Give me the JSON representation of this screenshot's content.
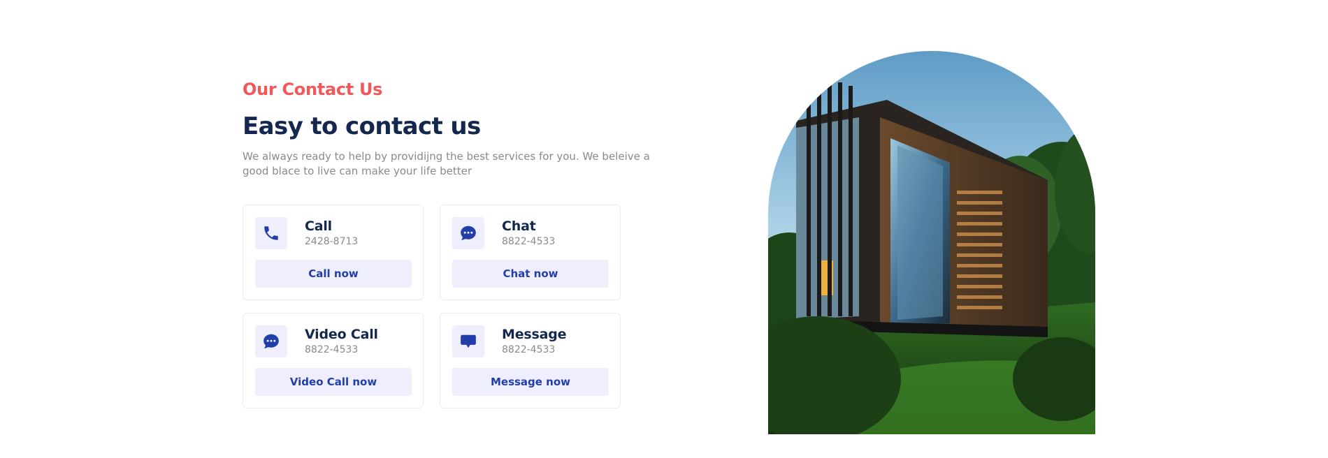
{
  "contact": {
    "eyebrow": "Our Contact Us",
    "heading": "Easy to contact us",
    "description": "We always ready to help by providijng the best services for you. We beleive a good blace to live can make your life better",
    "cards": [
      {
        "title": "Call",
        "number": "2428-8713",
        "button": "Call now",
        "icon": "phone-icon"
      },
      {
        "title": "Chat",
        "number": "8822-4533",
        "button": "Chat now",
        "icon": "chat-bubble-icon"
      },
      {
        "title": "Video Call",
        "number": "8822-4533",
        "button": "Video Call now",
        "icon": "chat-bubble-icon"
      },
      {
        "title": "Message",
        "number": "8822-4533",
        "button": "Message now",
        "icon": "message-icon"
      }
    ]
  },
  "colors": {
    "accent": "#f2575a",
    "heading": "#14284f",
    "primary": "#223ea8",
    "button_bg": "#eeeefc",
    "muted_text": "#8a8a8a"
  },
  "image": {
    "subject": "modern container house in a forest"
  }
}
